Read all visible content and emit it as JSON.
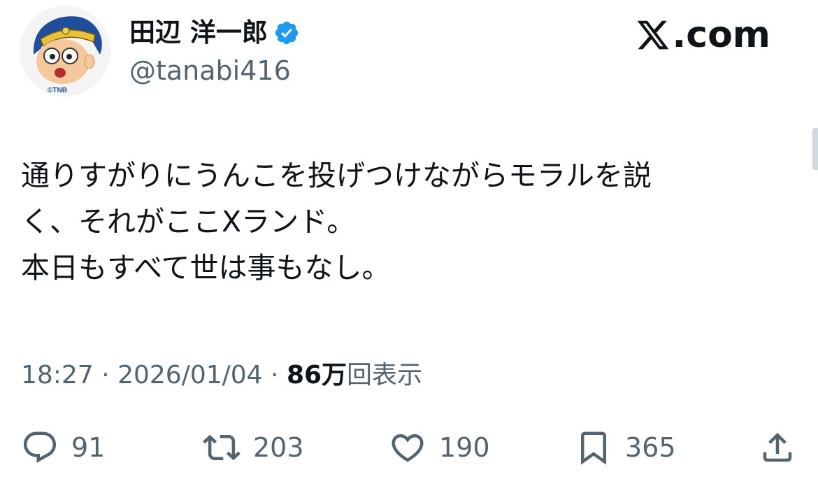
{
  "user": {
    "display_name": "田辺 洋一郎",
    "handle": "@tanabi416",
    "verified_icon": "verified-badge-icon",
    "avatar_label": "©TNB"
  },
  "brand": {
    "text": ".com",
    "logo_icon": "x-logo-icon"
  },
  "tweet": {
    "lines": [
      "通りすがりにうんこを投げつけながらモラルを説",
      "く、それがここXランド。",
      "本日もすべて世は事もなし。"
    ]
  },
  "meta": {
    "time": "18:27",
    "separator": " · ",
    "date": "2026/01/04",
    "views_number": "86万",
    "views_label": "回表示"
  },
  "actions": {
    "reply": {
      "icon": "reply-icon",
      "count": "91"
    },
    "repost": {
      "icon": "repost-icon",
      "count": "203"
    },
    "like": {
      "icon": "heart-icon",
      "count": "190"
    },
    "bookmark": {
      "icon": "bookmark-icon",
      "count": "365"
    },
    "share": {
      "icon": "share-icon"
    }
  },
  "colors": {
    "text": "#0f1419",
    "secondary": "#536471",
    "verified": "#1d9bf0"
  }
}
